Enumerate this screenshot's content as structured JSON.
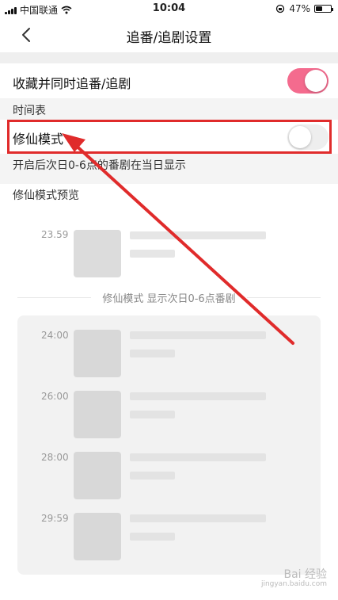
{
  "status_bar": {
    "carrier": "中国联通",
    "time": "10:04",
    "battery": "47%",
    "battery_level": 0.47
  },
  "nav": {
    "title": "追番/追剧设置"
  },
  "settings": {
    "collect_follow_label": "收藏并同时追番/追剧",
    "collect_follow_on": true,
    "schedule_section": "时间表",
    "xiuxian_label": "修仙模式",
    "xiuxian_on": false,
    "xiuxian_desc": "开启后次日0-6点的番剧在当日显示",
    "preview_section": "修仙模式预览"
  },
  "preview": {
    "before_time": "23.59",
    "divider_text": "修仙模式 显示次日0-6点番剧",
    "card_times": [
      "24:00",
      "26:00",
      "28:00",
      "29:59"
    ]
  },
  "watermark": {
    "brand": "Bai 经验",
    "url": "jingyan.baidu.com"
  },
  "colors": {
    "toggle_on": "#f46b8e",
    "highlight": "#e02b2b"
  }
}
